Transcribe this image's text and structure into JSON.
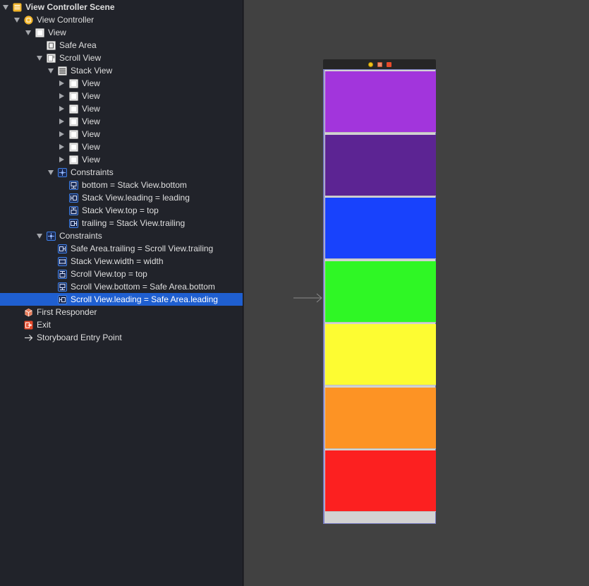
{
  "outline": {
    "rows": [
      {
        "label": "View Controller Scene",
        "name": "outline-view-controller-scene",
        "icon": "scene-icon",
        "disc": "open",
        "level": 0,
        "bold": true
      },
      {
        "label": "View Controller",
        "name": "outline-view-controller",
        "icon": "view-controller-icon",
        "disc": "open",
        "level": 1
      },
      {
        "label": "View",
        "name": "outline-view",
        "icon": "view-icon",
        "disc": "open",
        "level": 2
      },
      {
        "label": "Safe Area",
        "name": "outline-safe-area",
        "icon": "safe-area-icon",
        "disc": "none",
        "level": 3
      },
      {
        "label": "Scroll View",
        "name": "outline-scroll-view",
        "icon": "scroll-view-icon",
        "disc": "open",
        "level": 3
      },
      {
        "label": "Stack View",
        "name": "outline-stack-view",
        "icon": "stack-view-icon",
        "disc": "open",
        "level": 4
      },
      {
        "label": "View",
        "name": "outline-stack-subview-1",
        "icon": "view-icon",
        "disc": "closed",
        "level": 5
      },
      {
        "label": "View",
        "name": "outline-stack-subview-2",
        "icon": "view-icon",
        "disc": "closed",
        "level": 5
      },
      {
        "label": "View",
        "name": "outline-stack-subview-3",
        "icon": "view-icon",
        "disc": "closed",
        "level": 5
      },
      {
        "label": "View",
        "name": "outline-stack-subview-4",
        "icon": "view-icon",
        "disc": "closed",
        "level": 5
      },
      {
        "label": "View",
        "name": "outline-stack-subview-5",
        "icon": "view-icon",
        "disc": "closed",
        "level": 5
      },
      {
        "label": "View",
        "name": "outline-stack-subview-6",
        "icon": "view-icon",
        "disc": "closed",
        "level": 5
      },
      {
        "label": "View",
        "name": "outline-stack-subview-7",
        "icon": "view-icon",
        "disc": "closed",
        "level": 5
      },
      {
        "label": "Constraints",
        "name": "outline-scroll-view-constraints",
        "icon": "constraints-icon",
        "disc": "open",
        "level": 4
      },
      {
        "label": "bottom = Stack View.bottom",
        "name": "outline-constraint-bottom",
        "icon": "constraint-bottom-icon",
        "disc": "none",
        "level": 5
      },
      {
        "label": "Stack View.leading = leading",
        "name": "outline-constraint-leading",
        "icon": "constraint-leading-icon",
        "disc": "none",
        "level": 5
      },
      {
        "label": "Stack View.top = top",
        "name": "outline-constraint-top",
        "icon": "constraint-top-icon",
        "disc": "none",
        "level": 5
      },
      {
        "label": "trailing = Stack View.trailing",
        "name": "outline-constraint-trailing",
        "icon": "constraint-trailing-icon",
        "disc": "none",
        "level": 5
      },
      {
        "label": "Constraints",
        "name": "outline-view-constraints",
        "icon": "constraints-icon",
        "disc": "open",
        "level": 3
      },
      {
        "label": "Safe Area.trailing = Scroll View.trailing",
        "name": "outline-constraint-safe-trailing",
        "icon": "constraint-trailing-icon",
        "disc": "none",
        "level": 4
      },
      {
        "label": "Stack View.width = width",
        "name": "outline-constraint-width",
        "icon": "constraint-width-icon",
        "disc": "none",
        "level": 4
      },
      {
        "label": "Scroll View.top = top",
        "name": "outline-constraint-scroll-top",
        "icon": "constraint-top-icon",
        "disc": "none",
        "level": 4
      },
      {
        "label": "Scroll View.bottom = Safe Area.bottom",
        "name": "outline-constraint-scroll-bottom",
        "icon": "constraint-bottom-icon",
        "disc": "none",
        "level": 4
      },
      {
        "label": "Scroll View.leading = Safe Area.leading",
        "name": "outline-constraint-scroll-leading",
        "icon": "constraint-leading-icon",
        "disc": "none",
        "level": 4,
        "selected": true
      },
      {
        "label": "First Responder",
        "name": "outline-first-responder",
        "icon": "first-responder-icon",
        "disc": "none",
        "level": 1
      },
      {
        "label": "Exit",
        "name": "outline-exit",
        "icon": "exit-icon",
        "disc": "none",
        "level": 1
      },
      {
        "label": "Storyboard Entry Point",
        "name": "outline-storyboard-entry-point",
        "icon": "entry-point-arrow-icon",
        "disc": "none",
        "level": 1
      }
    ]
  },
  "canvas": {
    "scene_dock_icons": [
      "view-controller-icon",
      "first-responder-icon",
      "exit-icon"
    ],
    "stack_colors": [
      "#a235dc",
      "#5c2493",
      "#1842fc",
      "#2ff725",
      "#fdfc32",
      "#fd9324",
      "#fc2020"
    ]
  },
  "colors": {
    "selection": "#1f5fd0",
    "sidebar_background": "#21232a",
    "canvas_background": "#414141",
    "icon_blue": "#3f80e8",
    "icon_orange": "#f29b34"
  }
}
